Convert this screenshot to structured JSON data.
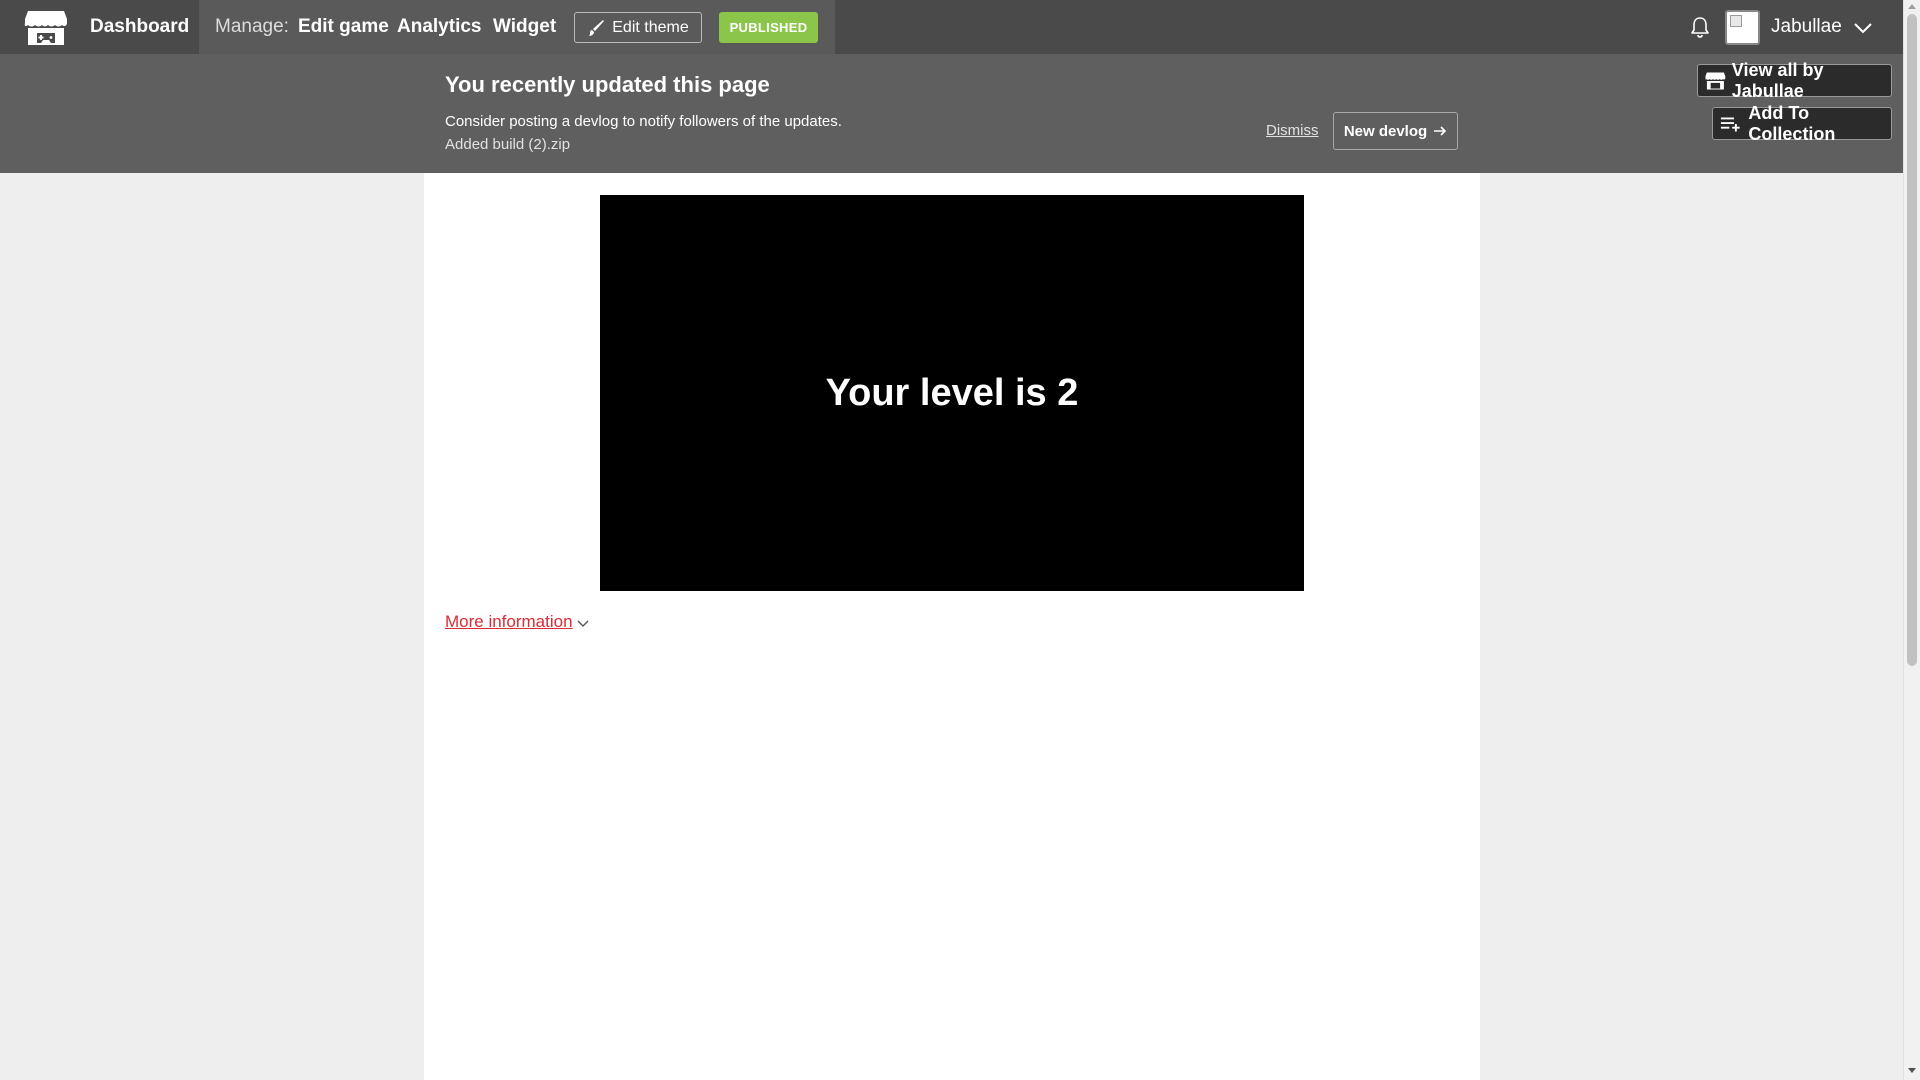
{
  "topbar": {
    "logo_icon": "itchio-logo-icon",
    "dashboard": "Dashboard",
    "manage_label": "Manage:",
    "edit_game": "Edit game",
    "analytics": "Analytics",
    "widget": "Widget",
    "edit_theme": "Edit theme",
    "edit_theme_icon": "brush-icon",
    "published": "PUBLISHED",
    "bell_icon": "bell-icon",
    "username": "Jabullae",
    "user_menu_icon": "chevron-down-icon"
  },
  "notice": {
    "title": "You recently updated this page",
    "subtitle": "Consider posting a devlog to notify followers of the updates.",
    "build": "Added build (2).zip",
    "dismiss": "Dismiss",
    "new_devlog": "New devlog",
    "new_devlog_icon": "arrow-right-icon"
  },
  "side_buttons": {
    "view_all": "View all by Jabullae",
    "add_collection": "Add To Collection"
  },
  "game": {
    "text": "Your level is 2"
  },
  "more_info": {
    "label": "More information"
  },
  "colors": {
    "topbar": "#4a4a4a",
    "manage_area": "#5a5a5a",
    "notice": "#5f5f5f",
    "published": "#8bc64b",
    "link": "#da2c38",
    "background": "#eeeeee"
  }
}
